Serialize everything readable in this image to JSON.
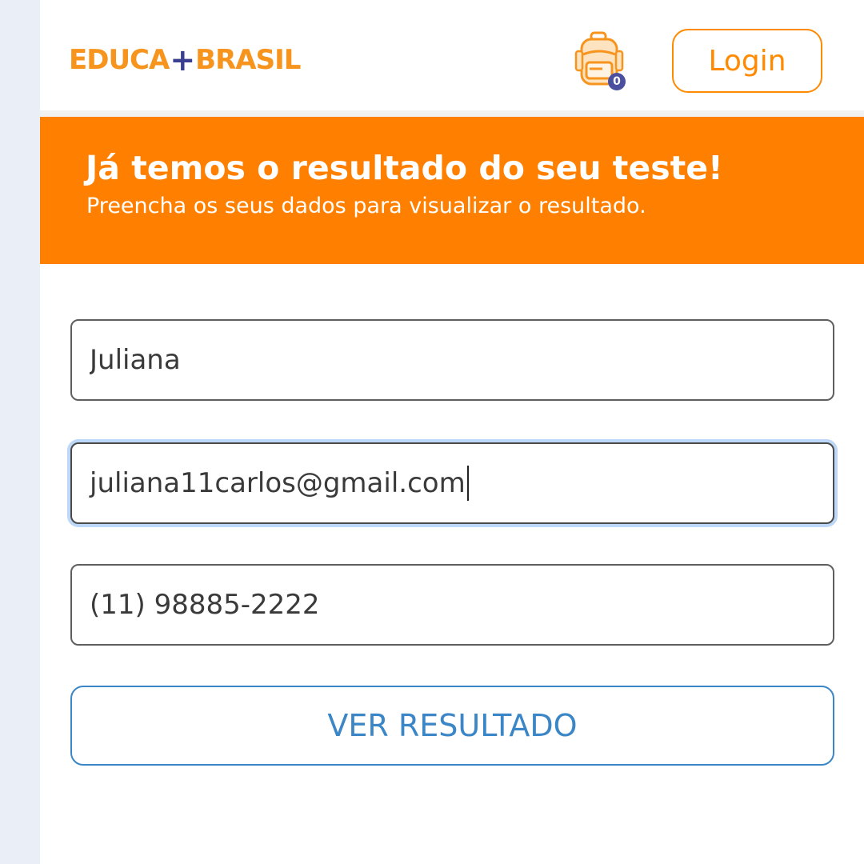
{
  "header": {
    "logo_left": "EDUCA",
    "logo_plus": "+",
    "logo_right": "BRASIL",
    "backpack_count": "0",
    "login_label": "Login"
  },
  "banner": {
    "title": "Já temos o resultado do seu teste!",
    "subtitle": "Preencha os seus dados para visualizar o resultado."
  },
  "form": {
    "name_value": "Juliana",
    "email_value": "juliana11carlos@gmail.com",
    "phone_value": "(11) 98885-2222",
    "submit_label": "VER RESULTADO"
  },
  "colors": {
    "brand_orange": "#ff8000",
    "logo_orange": "#f7941d",
    "logo_plus": "#3b3f8f",
    "button_blue": "#3a86c6",
    "focus_ring": "#bcd7f7",
    "side_strip": "#e9eef7"
  },
  "icons": {
    "cart": "backpack-icon"
  }
}
